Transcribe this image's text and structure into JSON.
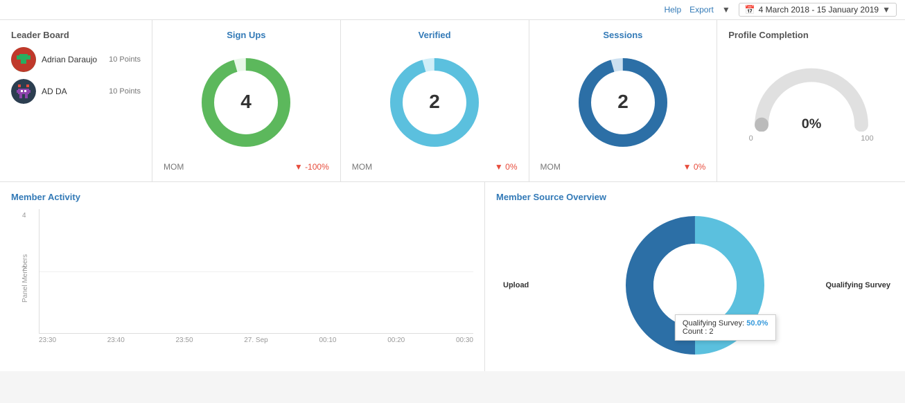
{
  "topbar": {
    "help_label": "Help",
    "export_label": "Export",
    "date_range": "4 March 2018 - 15 January 2019",
    "calendar_icon": "📅"
  },
  "leader_board": {
    "title": "Leader Board",
    "members": [
      {
        "name": "Adrian Daraujo",
        "points": "10 Points",
        "avatar_color1": "#c0392b",
        "avatar_color2": "#27ae60"
      },
      {
        "name": "AD DA",
        "points": "10 Points",
        "avatar_color1": "#8e44ad",
        "avatar_color2": "#2c3e50"
      }
    ]
  },
  "sign_ups": {
    "title": "Sign Ups",
    "value": "4",
    "mom_label": "MOM",
    "mom_value": "-100%",
    "donut_color": "#5cb85c",
    "donut_bg": "#e8f8e8"
  },
  "verified": {
    "title": "Verified",
    "value": "2",
    "mom_label": "MOM",
    "mom_value": "0%",
    "donut_color": "#5bc0de",
    "donut_bg": "#e8f6fc"
  },
  "sessions": {
    "title": "Sessions",
    "value": "2",
    "mom_label": "MOM",
    "mom_value": "0%",
    "donut_color": "#2c6fa6",
    "donut_bg": "#dce9f5"
  },
  "profile_completion": {
    "title": "Profile Completion",
    "value": "0",
    "unit": "%",
    "min_label": "0",
    "max_label": "100"
  },
  "member_activity": {
    "title": "Member Activity",
    "y_axis_label": "Panel Members",
    "y_labels": [
      "4",
      "2"
    ],
    "x_labels": [
      "23:30",
      "23:40",
      "23:50",
      "27. Sep",
      "00:10",
      "00:20",
      "00:30"
    ]
  },
  "member_source": {
    "title": "Member Source Overview",
    "segments": [
      {
        "label": "Upload",
        "color": "#5bc0de",
        "percent": 50.0
      },
      {
        "label": "Qualifying Survey",
        "color": "#2c6fa6",
        "percent": 50.0
      }
    ],
    "tooltip": {
      "label": "Qualifying Survey:",
      "percent": "50.0%",
      "count_label": "Count :",
      "count_value": "2"
    }
  }
}
